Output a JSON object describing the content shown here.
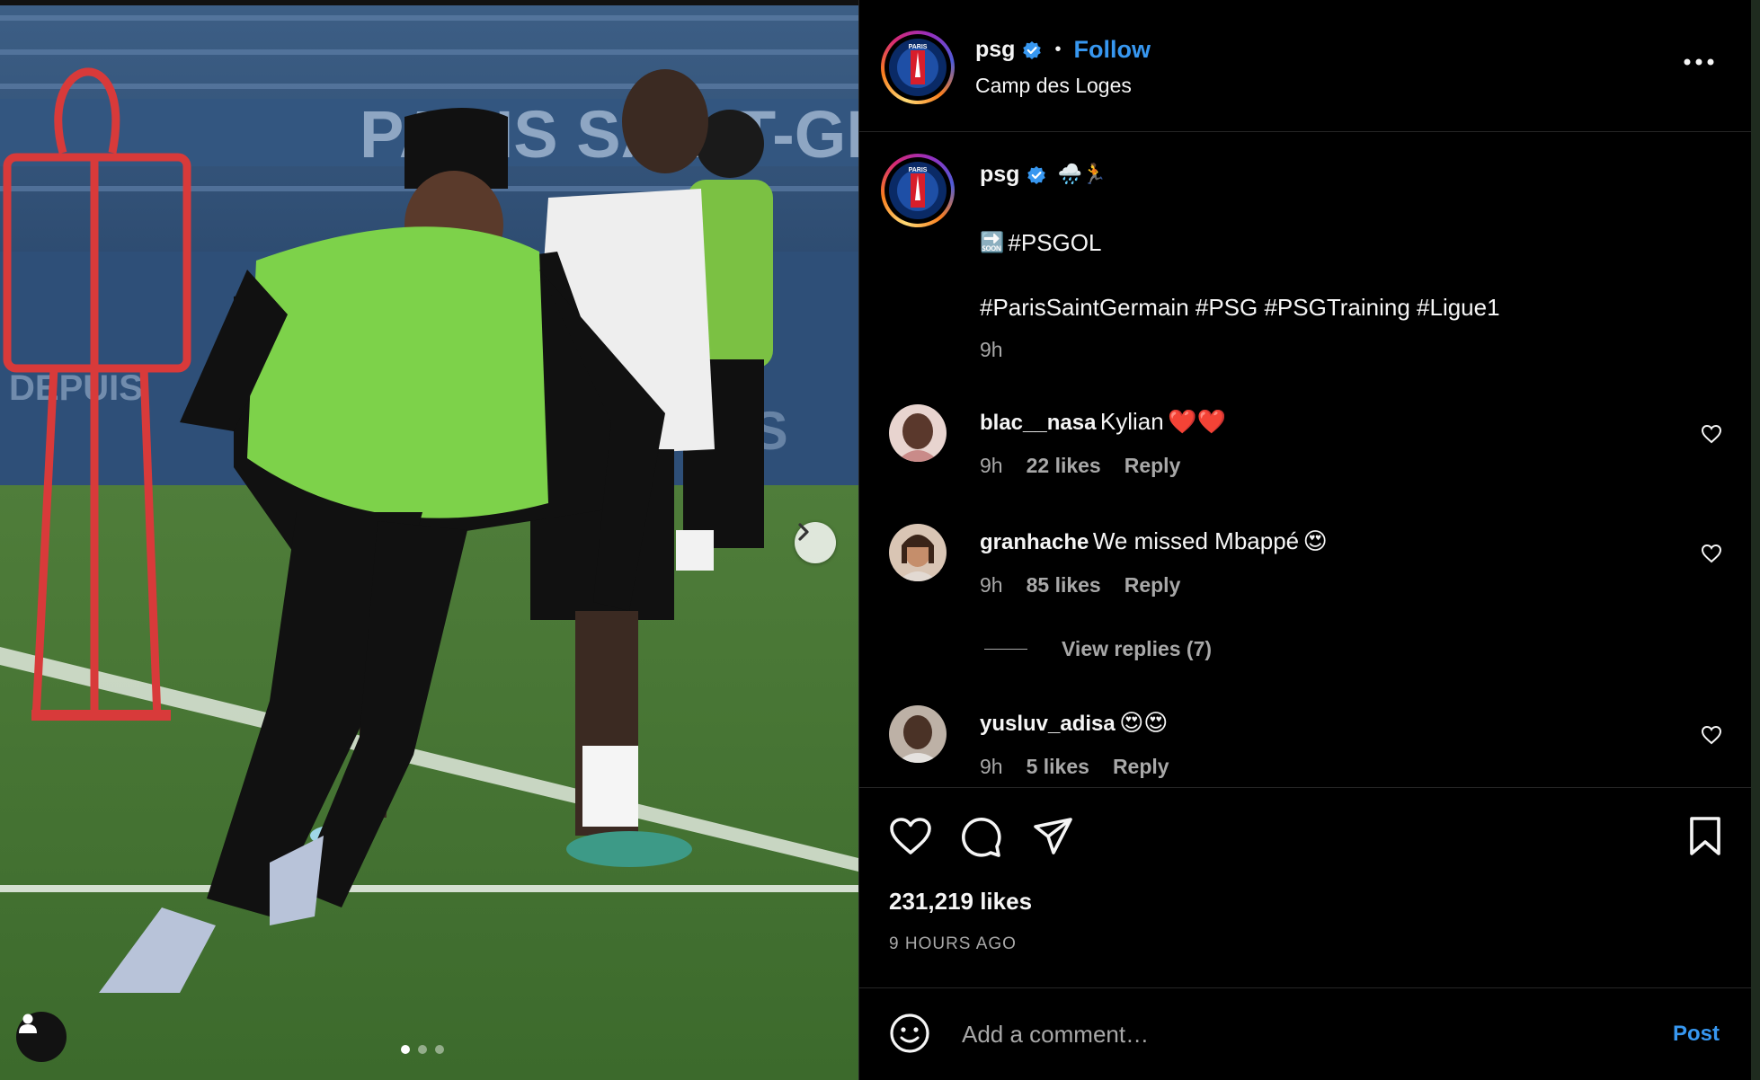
{
  "post": {
    "username": "psg",
    "separator": "•",
    "follow_label": "Follow",
    "location": "Camp des Loges",
    "more_icon": "more-horizontal-icon"
  },
  "caption": {
    "username": "psg",
    "emojis": "🌧️🏃",
    "soon_emoji": "🔜",
    "line1": "#PSGOL",
    "line2": "#ParisSaintGermain #PSG #PSGTraining #Ligue1",
    "time": "9h"
  },
  "comments": [
    {
      "username": "blac__nasa",
      "text": "Kylian",
      "emoji": "❤️❤️",
      "time": "9h",
      "likes": "22 likes",
      "reply": "Reply"
    },
    {
      "username": "granhache",
      "text": "We missed Mbappé",
      "emoji": "😍",
      "time": "9h",
      "likes": "85 likes",
      "reply": "Reply"
    },
    {
      "username": "yusluv_adisa",
      "text": "",
      "emoji": "😍😍",
      "time": "9h",
      "likes": "5 likes",
      "reply": "Reply"
    }
  ],
  "view_replies": "View replies (7)",
  "actions": {
    "likes": "231,219 likes",
    "posted": "9 HOURS AGO"
  },
  "add_comment": {
    "placeholder": "Add a comment…",
    "post_label": "Post"
  },
  "carousel": {
    "index": 1,
    "total": 3
  },
  "colors": {
    "accent": "#3797f0",
    "muted": "#a8a8a8",
    "background": "#000000",
    "border": "#262626"
  }
}
